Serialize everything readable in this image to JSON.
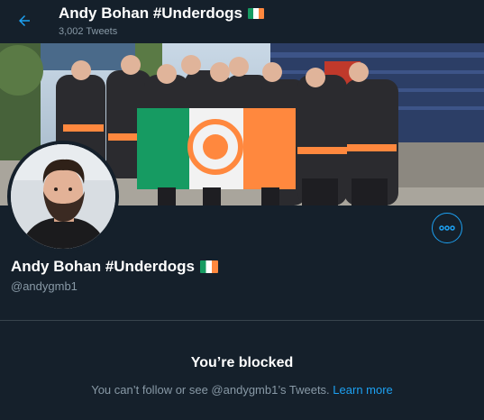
{
  "header": {
    "display_name": "Andy Bohan #Underdogs",
    "tweet_count": "3,002 Tweets",
    "back_icon": "arrow-left-icon",
    "flag_icon": "ireland-flag-icon"
  },
  "profile": {
    "display_name": "Andy Bohan #Underdogs",
    "handle": "@andygmb1",
    "more_icon": "more-horizontal-icon"
  },
  "blocked": {
    "title": "You’re blocked",
    "message_prefix": "You can’t follow or see @andygmb1’s Tweets.",
    "learn_more": "Learn more"
  },
  "colors": {
    "background": "#15202b",
    "accent": "#1da1f2",
    "secondary_text": "#8899a6",
    "divider": "#38444d"
  }
}
